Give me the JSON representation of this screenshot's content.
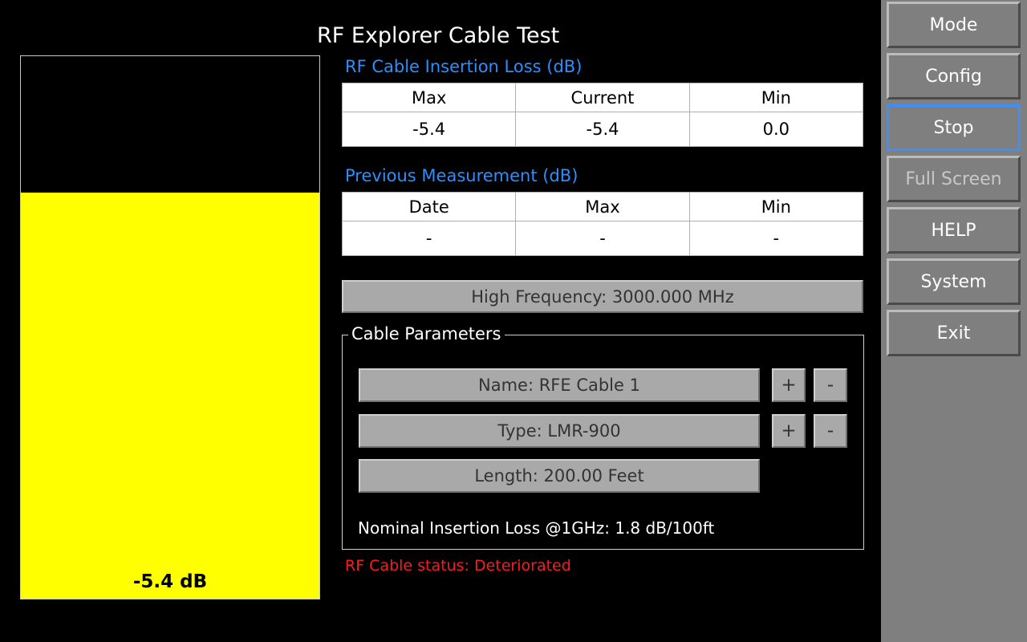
{
  "app": {
    "title": "RF Explorer Cable Test"
  },
  "meter": {
    "value_label": "-5.4 dB",
    "fill_fraction": 0.748,
    "fill_color": "#ffff00"
  },
  "insertion_loss": {
    "title": "RF Cable Insertion Loss (dB)",
    "headers": [
      "Max",
      "Current",
      "Min"
    ],
    "values": [
      "-5.4",
      "-5.4",
      "0.0"
    ]
  },
  "previous": {
    "title": "Previous Measurement (dB)",
    "headers": [
      "Date",
      "Max",
      "Min"
    ],
    "values": [
      "-",
      "-",
      "-"
    ]
  },
  "frequency": {
    "label": "High Frequency: 3000.000 MHz"
  },
  "cable_params": {
    "legend": "Cable Parameters",
    "name": "Name: RFE Cable 1",
    "type": "Type: LMR-900",
    "length": "Length: 200.00 Feet",
    "plus": "+",
    "minus": "-",
    "nominal": "Nominal Insertion Loss @1GHz: 1.8 dB/100ft"
  },
  "status": {
    "text": "RF Cable status: Deteriorated",
    "color": "#ff1a1a"
  },
  "sidebar": {
    "mode": "Mode",
    "config": "Config",
    "stop": "Stop",
    "full_screen": "Full Screen",
    "help": "HELP",
    "system": "System",
    "exit": "Exit"
  }
}
